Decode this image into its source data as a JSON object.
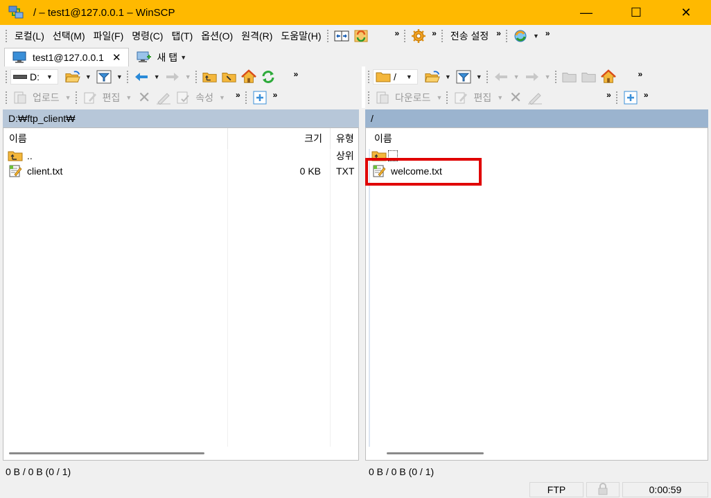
{
  "window": {
    "title": "/ – test1@127.0.0.1 – WinSCP",
    "minimize": "—",
    "maximize": "☐",
    "close": "✕"
  },
  "menu": {
    "items": [
      "로컬(L)",
      "선택(M)",
      "파일(F)",
      "명령(C)",
      "탭(T)",
      "옵션(O)",
      "원격(R)",
      "도움말(H)"
    ],
    "transfer_settings": "전송 설정",
    "chevron": "»"
  },
  "tabs": {
    "session": "test1@127.0.0.1",
    "close": "✕",
    "new_tab": "새 탭"
  },
  "local": {
    "drive": "D:",
    "upload": "업로드",
    "edit": "편집",
    "properties": "속성",
    "path": "D:₩ftp_client₩",
    "columns": {
      "name": "이름",
      "size": "크기",
      "type": "유형"
    },
    "files": [
      {
        "name": "..",
        "size": "",
        "type": "상위",
        "icon": "parent-dir-icon"
      },
      {
        "name": "client.txt",
        "size": "0 KB",
        "type": "TXT",
        "icon": "text-file-icon"
      }
    ],
    "status": "0 B / 0 B (0 / 1)"
  },
  "remote": {
    "path_box": "/",
    "download": "다운로드",
    "edit": "편집",
    "path": "/",
    "columns": {
      "name": "이름"
    },
    "files": [
      {
        "name": "",
        "icon": "parent-dir-icon"
      },
      {
        "name": "welcome.txt",
        "icon": "text-file-icon"
      }
    ],
    "status": "0 B / 0 B (0 / 1)"
  },
  "bottom": {
    "protocol": "FTP",
    "elapsed": "0:00:59"
  },
  "colors": {
    "titlebar": "#ffb900",
    "local_path_bg": "#b7c7d9",
    "remote_path_bg": "#9bb4cf",
    "highlight": "#e00000"
  }
}
